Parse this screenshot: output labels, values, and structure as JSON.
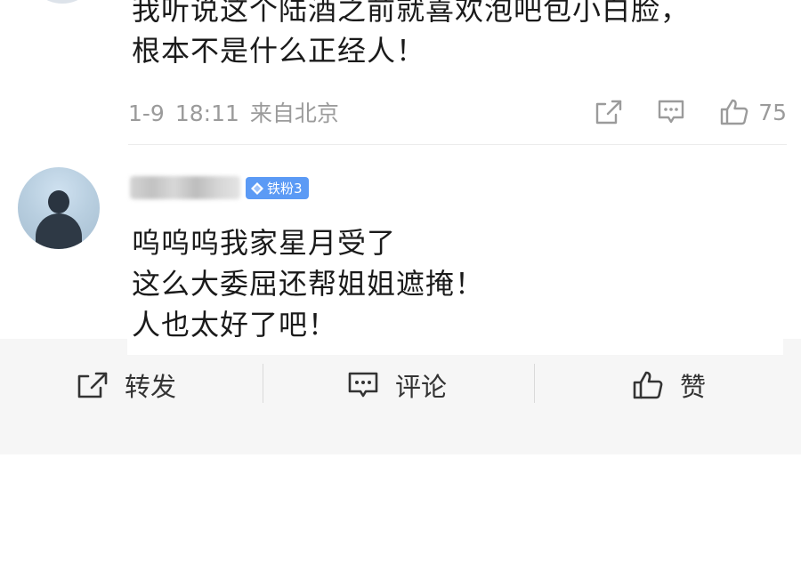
{
  "comment_top": {
    "text_lines": [
      "我听说这个陆酒之前就喜欢泡吧包小白脸，",
      "根本不是什么正经人！"
    ],
    "date": "1-9",
    "time": "18:11",
    "location": "来自北京",
    "like_count": "75"
  },
  "comment_second": {
    "username": "",
    "badge_label": "铁粉3",
    "text_lines": [
      "呜呜呜我家星月受了",
      "这么大委屈还帮姐姐遮掩！",
      "人也太好了吧！"
    ]
  },
  "bottom_bar": {
    "repost_label": "转发",
    "comment_label": "评论",
    "like_label": "赞"
  },
  "colors": {
    "text": "#1a1a1a",
    "meta_gray": "#9b9b9b",
    "badge_blue": "#5b9af5",
    "bar_background": "#f6f6f6"
  },
  "icons": {
    "repost": "share-square-icon",
    "comment": "comment-bubble-icon",
    "like": "thumbs-up-icon",
    "badge": "diamond-icon"
  }
}
